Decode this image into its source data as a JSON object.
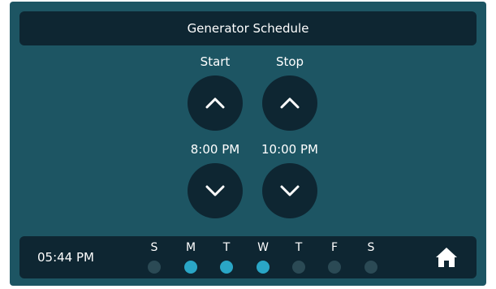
{
  "header": {
    "title": "Generator Schedule"
  },
  "schedule": {
    "start_label": "Start",
    "stop_label": "Stop",
    "start_time": "8:00 PM",
    "stop_time": "10:00 PM"
  },
  "footer": {
    "clock": "05:44 PM",
    "days": [
      {
        "letter": "S",
        "active": false
      },
      {
        "letter": "M",
        "active": true
      },
      {
        "letter": "T",
        "active": true
      },
      {
        "letter": "W",
        "active": true
      },
      {
        "letter": "T",
        "active": false
      },
      {
        "letter": "F",
        "active": false
      },
      {
        "letter": "S",
        "active": false
      }
    ]
  },
  "icons": {
    "up": "chevron-up-icon",
    "down": "chevron-down-icon",
    "home": "home-icon"
  },
  "colors": {
    "background": "#1d5563",
    "panel": "#0e2632",
    "day_active": "#2aa6c6",
    "day_inactive": "#2b4a55"
  }
}
